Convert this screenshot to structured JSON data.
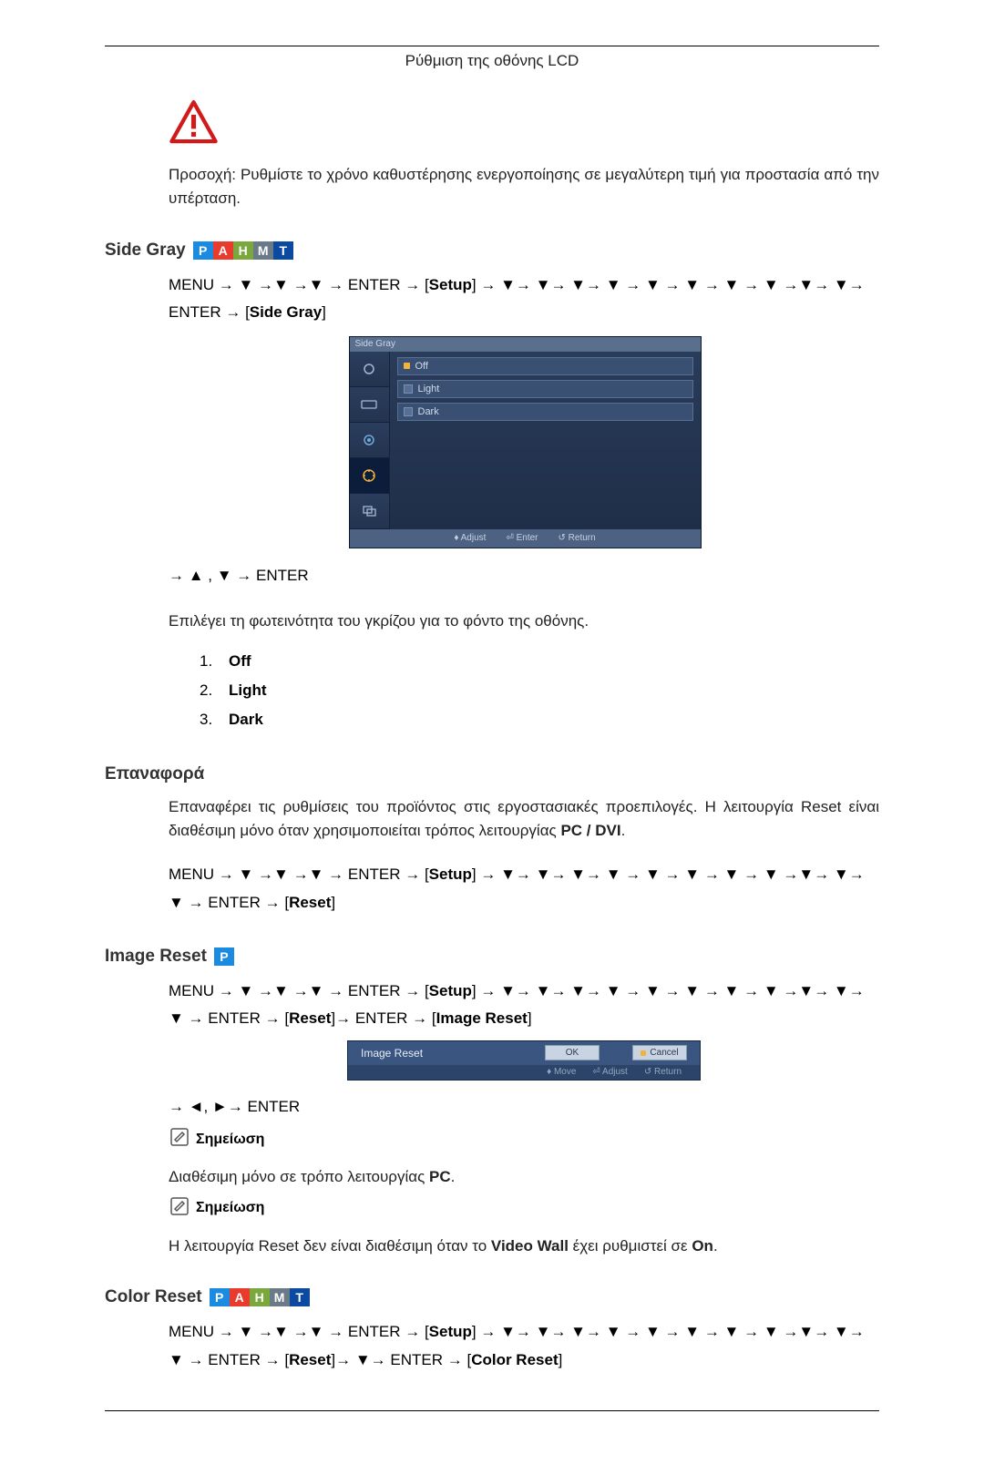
{
  "header": {
    "title": "Ρύθμιση της οθόνης LCD"
  },
  "icons": {
    "warning": "warning-triangle",
    "note": "pencil-note"
  },
  "warning_paragraph": "Προσοχή: Ρυθμίστε το χρόνο καθυστέρησης ενεργοποίησης σε μεγαλύτερη τιμή για προστασία από την υπέρταση.",
  "badges": {
    "p": "P",
    "a": "A",
    "h": "H",
    "m": "M",
    "t": "T"
  },
  "side_gray": {
    "heading": "Side Gray",
    "nav1_a": "MENU → ▼ →▼ →▼ → ENTER → ",
    "nav1_setup": "Setup",
    "nav1_b": " → ▼→ ▼→ ▼→ ▼ → ▼ → ▼ → ▼ → ▼ →▼→ ▼→ ENTER → ",
    "nav1_sidegray": "Side Gray",
    "osd": {
      "title": "Side Gray",
      "rows": [
        "Off",
        "Light",
        "Dark"
      ],
      "footer": [
        "♦ Adjust",
        "⏎ Enter",
        "↺ Return"
      ]
    },
    "nav2": "→ ▲ , ▼ → ENTER",
    "desc": "Επιλέγει τη φωτεινότητα του γκρίζου για το φόντο της οθόνης.",
    "options": [
      "Off",
      "Light",
      "Dark"
    ]
  },
  "reset": {
    "heading": "Επαναφορά",
    "desc_a": "Επαναφέρει τις ρυθμίσεις του προϊόντος στις εργοστασιακές προεπιλογές. Η λειτουργία Reset είναι διαθέσιμη μόνο όταν χρησιμοποιείται τρόπος λειτουργίας ",
    "desc_b_bold": "PC / DVI",
    "desc_c": ".",
    "nav_a": "MENU → ▼ →▼ →▼ → ENTER → ",
    "nav_setup": "Setup",
    "nav_b": " → ▼→ ▼→ ▼→ ▼ → ▼ → ▼ → ▼ → ▼ →▼→ ▼→ ▼ → ENTER → ",
    "nav_reset": "Reset"
  },
  "image_reset": {
    "heading": "Image Reset",
    "nav_a": "MENU → ▼ →▼ →▼ → ENTER → ",
    "nav_setup": "Setup",
    "nav_b": " → ▼→ ▼→ ▼→ ▼ → ▼ → ▼ → ▼ → ▼ →▼→ ▼→ ▼ → ENTER → ",
    "nav_reset": "Reset",
    "nav_c": "→ ENTER → ",
    "nav_imagereset": "Image Reset",
    "osd": {
      "title": "Image Reset",
      "ok": "OK",
      "cancel": "Cancel",
      "footer": [
        "♦ Move",
        "⏎ Adjust",
        "↺ Return"
      ]
    },
    "nav2": "→ ◄, ►→ ENTER",
    "note_label": "Σημείωση",
    "note1_a": "Διαθέσιμη μόνο σε τρόπο λειτουργίας ",
    "note1_b_bold": "PC",
    "note1_c": ".",
    "note2_a": "Η λειτουργία Reset δεν είναι διαθέσιμη όταν το ",
    "note2_b_bold": "Video Wall",
    "note2_c": " έχει ρυθμιστεί σε ",
    "note2_d_bold": "On",
    "note2_e": "."
  },
  "color_reset": {
    "heading": "Color Reset",
    "nav_a": "MENU → ▼ →▼ →▼ → ENTER → ",
    "nav_setup": "Setup",
    "nav_b": " → ▼→ ▼→ ▼→ ▼ → ▼ → ▼ → ▼ → ▼ →▼→ ▼→ ▼ → ENTER → ",
    "nav_reset": "Reset",
    "nav_c": "→ ▼→ ENTER → ",
    "nav_colorreset": "Color Reset"
  }
}
